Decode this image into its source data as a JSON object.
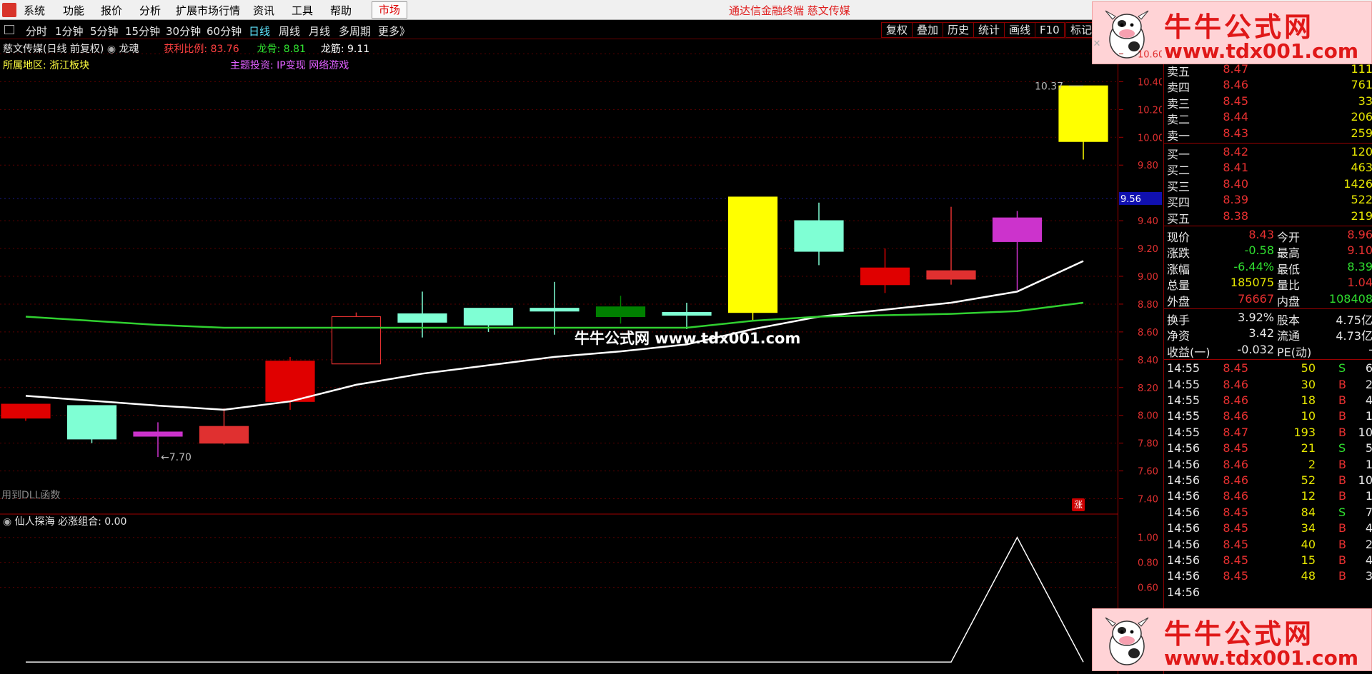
{
  "menubar": {
    "items": [
      "系统",
      "功能",
      "报价",
      "分析",
      "扩展市场行情",
      "资讯",
      "工具",
      "帮助"
    ],
    "market_label": "市场",
    "app_title": "通达信金融终端  慈文传媒"
  },
  "periodbar": {
    "items": [
      "分时",
      "1分钟",
      "5分钟",
      "15分钟",
      "30分钟",
      "60分钟",
      "日线",
      "周线",
      "月线",
      "多周期",
      "更多》"
    ],
    "active": "日线",
    "tools": [
      "复权",
      "叠加",
      "历史",
      "统计",
      "画线",
      "F10",
      "标记"
    ]
  },
  "stock_info": {
    "name": "慈文传媒(日线 前复权)",
    "indicator": "龙魂",
    "profit_label": "获利比例:",
    "profit_value": "83.76",
    "longgu_label": "龙骨:",
    "longgu_value": "8.81",
    "longjin_label": "龙筋:",
    "longjin_value": "9.11",
    "region": "所属地区: 浙江板块",
    "theme": "主题投资: IP变现 网络游戏"
  },
  "main_chart": {
    "y_ticks": [
      "10.60",
      "10.40",
      "10.20",
      "10.00",
      "9.80",
      "9.56",
      "9.40",
      "9.20",
      "9.00",
      "8.80",
      "8.60",
      "8.40",
      "8.20",
      "8.00",
      "7.80",
      "7.60",
      "7.40"
    ],
    "current_price_tag": "9.56",
    "high_label": "10.37",
    "low_label": "7.70",
    "dll_note": "用到DLL函数",
    "watermark": "牛牛公式网 www.tdx001.com",
    "zhang": "涨"
  },
  "chart_data": {
    "type": "candlestick",
    "ylim": [
      7.3,
      10.7
    ],
    "candles": [
      {
        "open": 7.98,
        "close": 8.08,
        "high": 8.08,
        "low": 7.96,
        "color": "#e00000"
      },
      {
        "open": 8.07,
        "close": 7.83,
        "high": 8.07,
        "low": 7.8,
        "color": "#7fffd4"
      },
      {
        "open": 7.88,
        "close": 7.85,
        "high": 7.95,
        "low": 7.7,
        "color": "#cc33cc"
      },
      {
        "open": 7.92,
        "close": 7.8,
        "high": 8.05,
        "low": 7.79,
        "color": "#e03030"
      },
      {
        "open": 8.1,
        "close": 8.39,
        "high": 8.42,
        "low": 8.04,
        "color": "#e00000"
      },
      {
        "open": 8.37,
        "close": 8.71,
        "high": 8.74,
        "low": 8.37,
        "color": "#e03030"
      },
      {
        "open": 8.73,
        "close": 8.67,
        "high": 8.89,
        "low": 8.56,
        "color": "#7fffd4"
      },
      {
        "open": 8.77,
        "close": 8.65,
        "high": 8.77,
        "low": 8.6,
        "color": "#7fffd4"
      },
      {
        "open": 8.77,
        "close": 8.75,
        "high": 8.96,
        "low": 8.58,
        "color": "#7fffd4"
      },
      {
        "open": 8.78,
        "close": 8.71,
        "high": 8.86,
        "low": 8.66,
        "color": "#008000"
      },
      {
        "open": 8.74,
        "close": 8.72,
        "high": 8.81,
        "low": 8.62,
        "color": "#7fffd4"
      },
      {
        "open": 8.74,
        "close": 9.57,
        "high": 9.57,
        "low": 8.68,
        "color": "#ffff00"
      },
      {
        "open": 9.4,
        "close": 9.18,
        "high": 9.53,
        "low": 9.08,
        "color": "#7fffd4"
      },
      {
        "open": 9.06,
        "close": 8.94,
        "high": 9.2,
        "low": 8.88,
        "color": "#e00000"
      },
      {
        "open": 9.04,
        "close": 8.98,
        "high": 9.5,
        "low": 8.94,
        "color": "#e03030"
      },
      {
        "open": 9.42,
        "close": 9.25,
        "high": 9.47,
        "low": 8.9,
        "color": "#cc33cc"
      },
      {
        "open": 9.97,
        "close": 10.37,
        "high": 10.37,
        "low": 9.84,
        "color": "#ffff00"
      }
    ],
    "series": [
      {
        "name": "龙筋",
        "color": "#ffffff",
        "values": [
          8.14,
          null,
          8.07,
          8.04,
          8.1,
          8.22,
          8.3,
          8.36,
          8.42,
          8.46,
          8.51,
          8.62,
          8.71,
          8.76,
          8.81,
          8.89,
          9.11
        ]
      },
      {
        "name": "龙骨",
        "color": "#30d030",
        "values": [
          8.71,
          null,
          8.65,
          8.63,
          8.63,
          8.63,
          8.63,
          8.63,
          8.63,
          8.63,
          8.63,
          8.68,
          8.71,
          8.72,
          8.73,
          8.75,
          8.81
        ]
      }
    ],
    "sub_chart": {
      "title": "仙人探海 必涨组合: 0.00",
      "y_ticks": [
        "1.00",
        "0.80",
        "0.60"
      ],
      "ylim": [
        -0.05,
        1.05
      ],
      "values": [
        0,
        0,
        0,
        0,
        0,
        0,
        0,
        0,
        0,
        0,
        0,
        0,
        0,
        0,
        0,
        1,
        0
      ]
    }
  },
  "quote_panel": {
    "sell": [
      {
        "label": "卖五",
        "price": "8.47",
        "vol": "111"
      },
      {
        "label": "卖四",
        "price": "8.46",
        "vol": "761"
      },
      {
        "label": "卖三",
        "price": "8.45",
        "vol": "33"
      },
      {
        "label": "卖二",
        "price": "8.44",
        "vol": "206"
      },
      {
        "label": "卖一",
        "price": "8.43",
        "vol": "259"
      }
    ],
    "buy": [
      {
        "label": "买一",
        "price": "8.42",
        "vol": "120"
      },
      {
        "label": "买二",
        "price": "8.41",
        "vol": "463"
      },
      {
        "label": "买三",
        "price": "8.40",
        "vol": "1426"
      },
      {
        "label": "买四",
        "price": "8.39",
        "vol": "522"
      },
      {
        "label": "买五",
        "price": "8.38",
        "vol": "219"
      }
    ],
    "stats": [
      {
        "l1": "现价",
        "v1": "8.43",
        "c1": "#e83030",
        "l2": "今开",
        "v2": "8.96",
        "c2": "#e83030"
      },
      {
        "l1": "涨跌",
        "v1": "-0.58",
        "c1": "#30e030",
        "l2": "最高",
        "v2": "9.10",
        "c2": "#e83030"
      },
      {
        "l1": "涨幅",
        "v1": "-6.44%",
        "c1": "#30e030",
        "l2": "最低",
        "v2": "8.39",
        "c2": "#30e030"
      },
      {
        "l1": "总量",
        "v1": "185075",
        "c1": "#e6e600",
        "l2": "量比",
        "v2": "1.04",
        "c2": "#e83030"
      },
      {
        "l1": "外盘",
        "v1": "76667",
        "c1": "#e83030",
        "l2": "内盘",
        "v2": "108408",
        "c2": "#30e030"
      }
    ],
    "stats2": [
      {
        "l1": "换手",
        "v1": "3.92%",
        "l2": "股本",
        "v2": "4.75亿"
      },
      {
        "l1": "净资",
        "v1": "3.42",
        "l2": "流通",
        "v2": "4.73亿"
      },
      {
        "l1": "收益(一)",
        "v1": "-0.032",
        "l2": "PE(动)",
        "v2": "-"
      }
    ],
    "ticks": [
      {
        "t": "14:55",
        "p": "8.45",
        "v": "50",
        "s": "S",
        "n": "6"
      },
      {
        "t": "14:55",
        "p": "8.46",
        "v": "30",
        "s": "B",
        "n": "2"
      },
      {
        "t": "14:55",
        "p": "8.46",
        "v": "18",
        "s": "B",
        "n": "4"
      },
      {
        "t": "14:55",
        "p": "8.46",
        "v": "10",
        "s": "B",
        "n": "1"
      },
      {
        "t": "14:55",
        "p": "8.47",
        "v": "193",
        "s": "B",
        "n": "10"
      },
      {
        "t": "14:56",
        "p": "8.45",
        "v": "21",
        "s": "S",
        "n": "5"
      },
      {
        "t": "14:56",
        "p": "8.46",
        "v": "2",
        "s": "B",
        "n": "1"
      },
      {
        "t": "14:56",
        "p": "8.46",
        "v": "52",
        "s": "B",
        "n": "10"
      },
      {
        "t": "14:56",
        "p": "8.46",
        "v": "12",
        "s": "B",
        "n": "1"
      },
      {
        "t": "14:56",
        "p": "8.45",
        "v": "84",
        "s": "S",
        "n": "7"
      },
      {
        "t": "14:56",
        "p": "8.45",
        "v": "34",
        "s": "B",
        "n": "4"
      },
      {
        "t": "14:56",
        "p": "8.45",
        "v": "40",
        "s": "B",
        "n": "2"
      },
      {
        "t": "14:56",
        "p": "8.45",
        "v": "15",
        "s": "B",
        "n": "4"
      },
      {
        "t": "14:56",
        "p": "8.45",
        "v": "48",
        "s": "B",
        "n": "3"
      },
      {
        "t": "14:56",
        "p": "",
        "v": "",
        "s": "",
        "n": ""
      }
    ]
  },
  "ads": {
    "title": "牛牛公式网",
    "url": "www.tdx001.com"
  },
  "colors": {
    "up": "#e83030",
    "down": "#30e030",
    "active_period": "#5fe6ff",
    "grid": "#5a0000"
  }
}
